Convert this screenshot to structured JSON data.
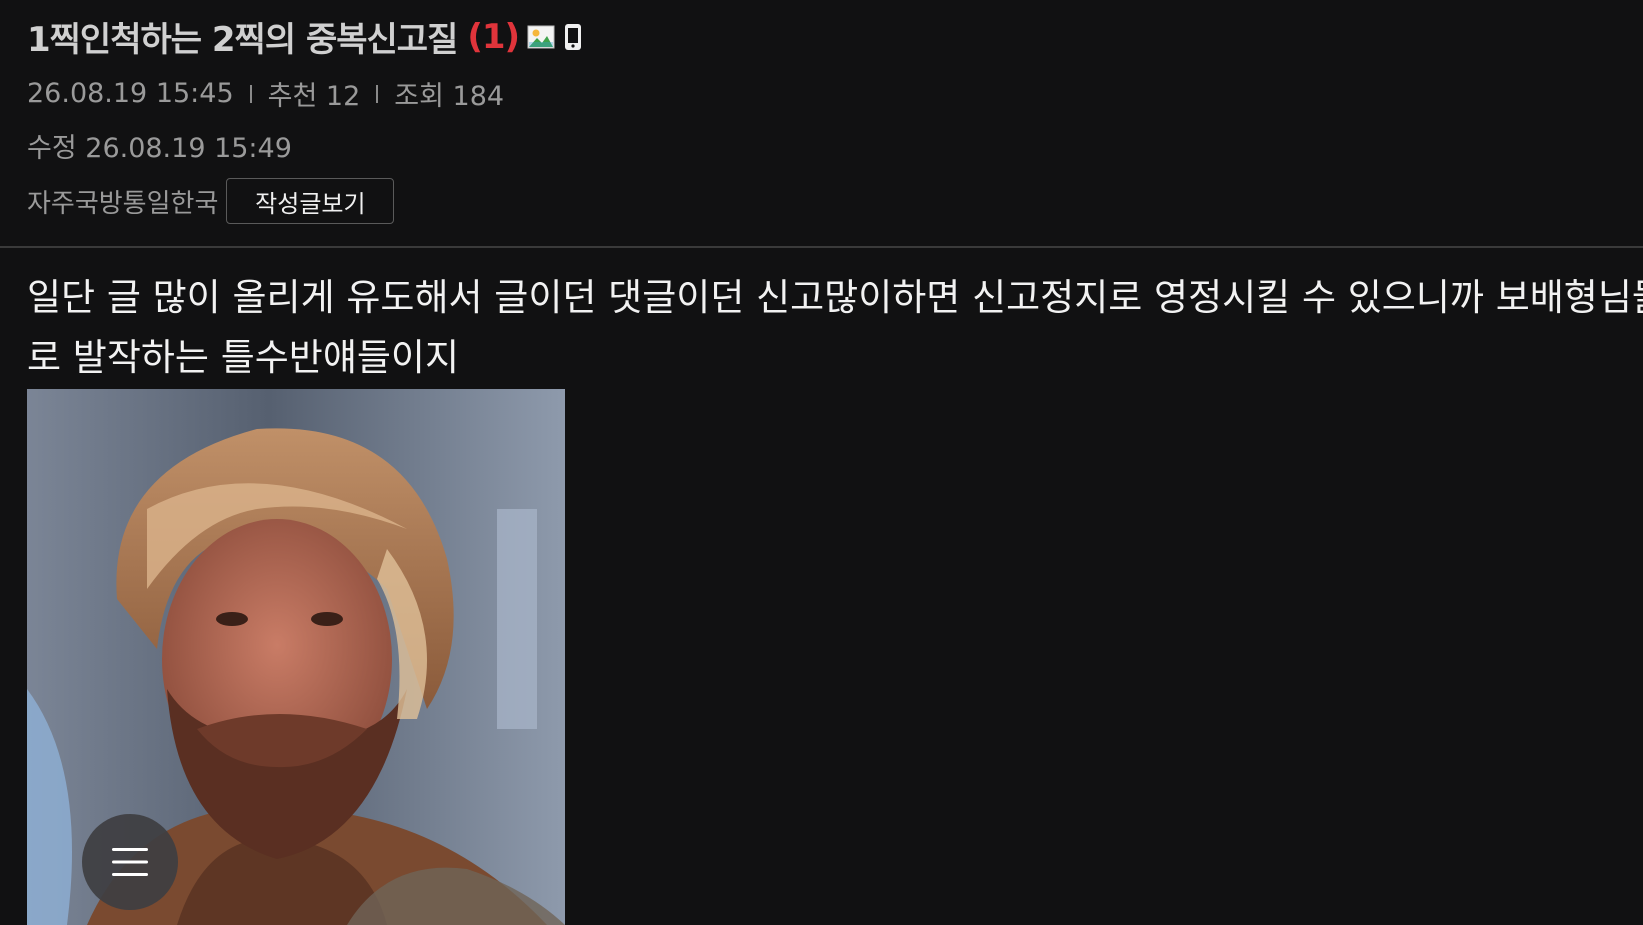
{
  "post": {
    "title": "1찍인척하는 2찍의 중복신고질",
    "comment_count": "(1)",
    "date": "26.08.19  15:45",
    "recommend": "추천 12",
    "views": "조회 184",
    "edited": "수정 26.08.19  15:49",
    "author": "자주국방통일한국",
    "view_posts_label": "작성글보기",
    "body_lines": [
      "일단 글 많이 올리게 유도해서 글이던 댓글이던 신고많이하면 신고정지로 영정시킬 수 있으니까 보배형님들께",
      "로 발작하는 틀수반얘들이지"
    ]
  },
  "icons": {
    "image_attachment": "image-icon",
    "mobile": "mobile-phone-icon",
    "menu": "hamburger-menu-icon"
  },
  "colors": {
    "background": "#111112",
    "comment_count": "#e0343b",
    "meta_text": "#9a9a9a"
  }
}
